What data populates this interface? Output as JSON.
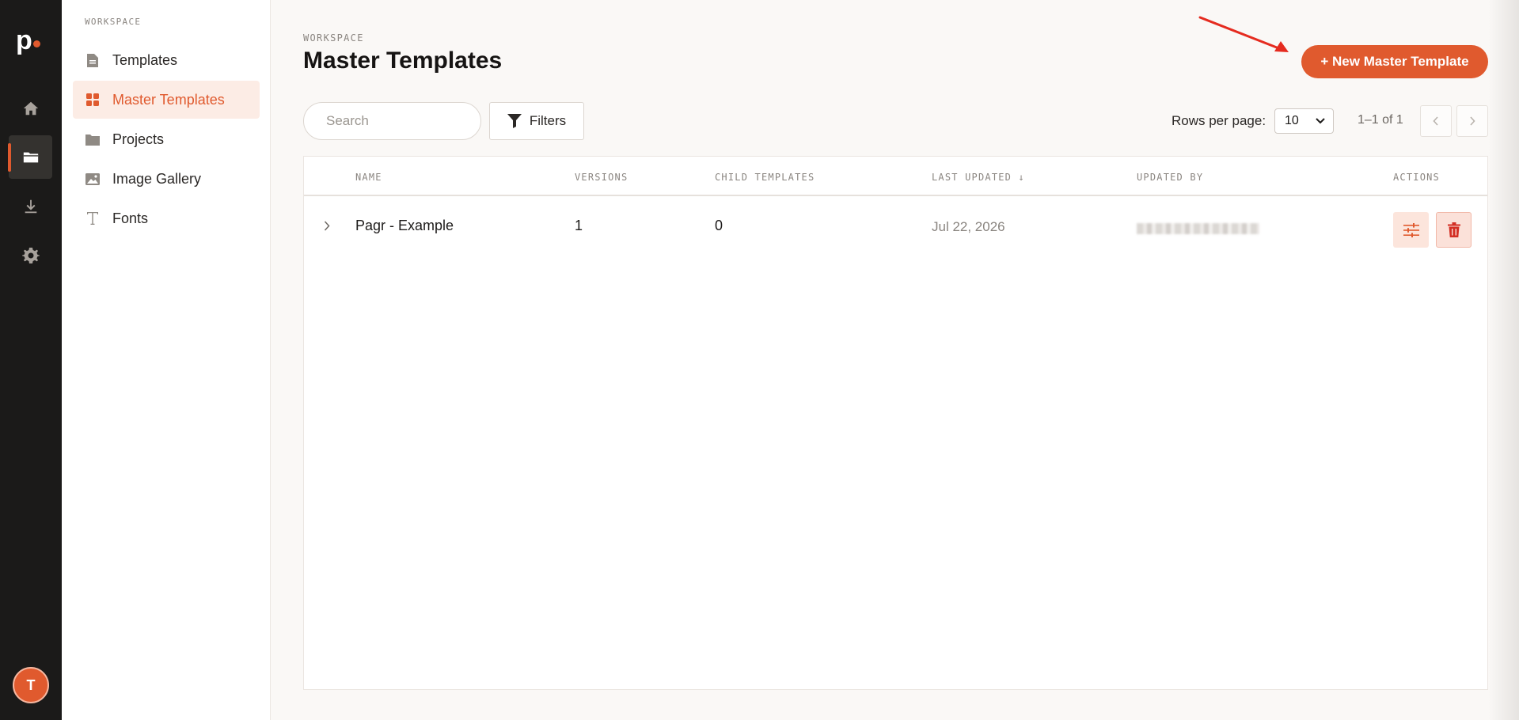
{
  "brand": {
    "logo_letter": "p",
    "accent": "#e05a2e"
  },
  "rail": {
    "items": [
      {
        "icon": "home-icon"
      },
      {
        "icon": "folder-icon",
        "active": true
      },
      {
        "icon": "download-icon"
      },
      {
        "icon": "gear-icon"
      }
    ],
    "avatar_initial": "T"
  },
  "sidebar": {
    "section_label": "WORKSPACE",
    "items": [
      {
        "label": "Templates",
        "icon": "document-icon"
      },
      {
        "label": "Master Templates",
        "icon": "grid-icon",
        "active": true
      },
      {
        "label": "Projects",
        "icon": "folder-icon"
      },
      {
        "label": "Image Gallery",
        "icon": "image-icon"
      },
      {
        "label": "Fonts",
        "icon": "type-icon"
      }
    ]
  },
  "header": {
    "breadcrumb": "WORKSPACE",
    "title": "Master Templates",
    "new_button_label": "+ New Master Template"
  },
  "toolbar": {
    "search_placeholder": "Search",
    "filters_label": "Filters",
    "rows_per_page_label": "Rows per page:",
    "rows_per_page_value": "10",
    "range_text": "1–1 of 1"
  },
  "table": {
    "columns": [
      "NAME",
      "VERSIONS",
      "CHILD TEMPLATES",
      "LAST UPDATED ↓",
      "UPDATED BY",
      "ACTIONS"
    ],
    "rows": [
      {
        "name": "Pagr - Example",
        "versions": "1",
        "child_templates": "0",
        "last_updated": "Jul 22, 2026"
      }
    ]
  }
}
